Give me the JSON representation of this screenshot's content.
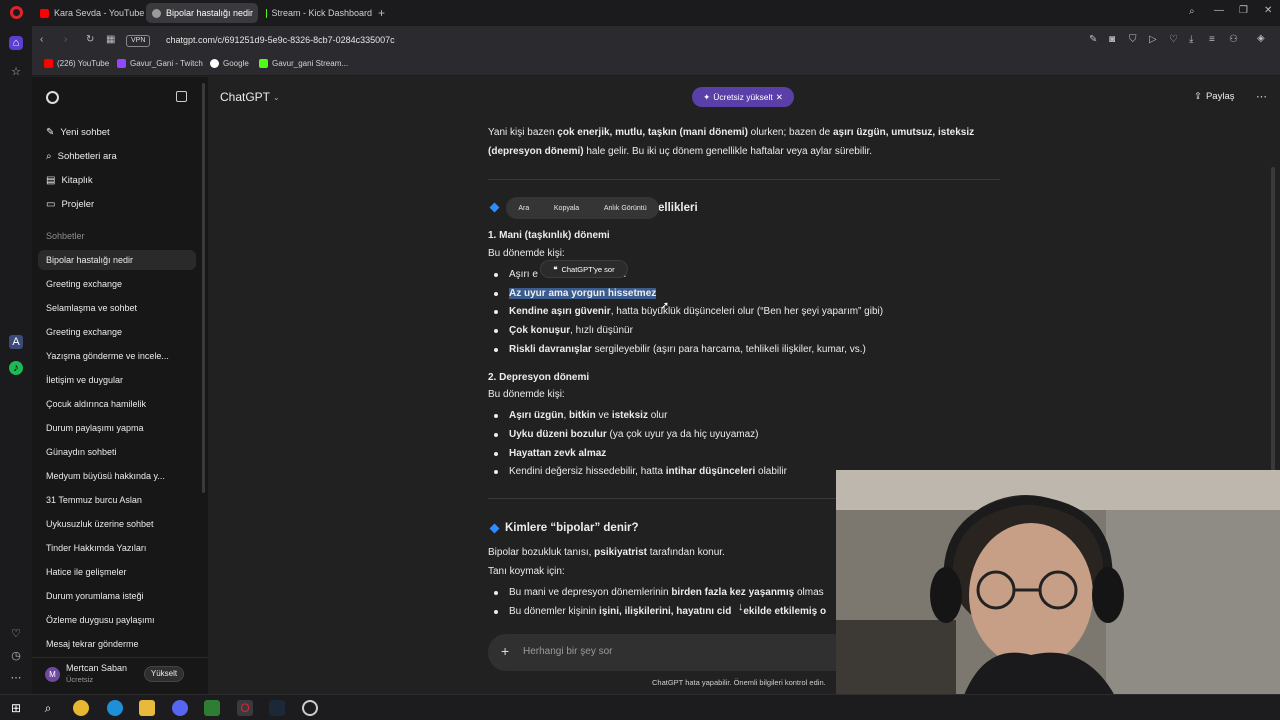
{
  "browser": {
    "tabs": [
      {
        "label": "Kara Sevda - YouTube",
        "color": "#ff0000"
      },
      {
        "label": "Bipolar hastalığı nedir",
        "color": "#9a9a9a"
      },
      {
        "label": "Stream - Kick Dashboard",
        "color": "#53fc18"
      }
    ],
    "url": "chatgpt.com/c/691251d9-5e9c-8326-8cb7-0284c335007c",
    "vpn_label": "VPN",
    "bookmarks": [
      {
        "label": "(226) YouTube",
        "color": "#ff0000"
      },
      {
        "label": "Gavur_Gani - Twitch",
        "color": "#9146ff"
      },
      {
        "label": "Google",
        "color": "#4285f4"
      },
      {
        "label": "Gavur_gani Stream...",
        "color": "#53fc18"
      }
    ]
  },
  "sidebar": {
    "nav": [
      {
        "label": "Yeni sohbet",
        "icon": "edit-icon"
      },
      {
        "label": "Sohbetleri ara",
        "icon": "search-icon"
      },
      {
        "label": "Kitaplık",
        "icon": "library-icon"
      },
      {
        "label": "Projeler",
        "icon": "folder-icon"
      }
    ],
    "section_title": "Sohbetler",
    "chats": [
      "Bipolar hastalığı nedir",
      "Greeting exchange",
      "Selamlaşma ve sohbet",
      "Greeting exchange",
      "Yazışma gönderme ve incele...",
      "İletişim ve duygular",
      "Çocuk aldırınca hamilelik",
      "Durum paylaşımı yapma",
      "Günaydın sohbeti",
      "Medyum büyüsü hakkında y...",
      "31 Temmuz burcu Aslan",
      "Uykusuzluk üzerine sohbet",
      "Tinder Hakkımda Yazıları",
      "Hatice ile gelişmeler",
      "Durum yorumlama isteği",
      "Özleme duygusu paylaşımı",
      "Mesaj tekrar gönderme"
    ],
    "user_name": "Mertcan Saban",
    "user_plan": "Ücretsiz",
    "user_initial": "M",
    "upgrade_label": "Yükselt"
  },
  "header": {
    "model": "ChatGPT",
    "upgrade_pill": "Ücretsiz yükselt",
    "share": "Paylaş"
  },
  "content": {
    "intro_1a": "Yani kişi bazen ",
    "intro_1b": "çok enerjik, mutlu, taşkın (mani dönemi)",
    "intro_1c": " olurken; bazen de ",
    "intro_1d": "aşırı üzgün, umutsuz, isteksiz",
    "intro_2a": "(depresyon dönemi)",
    "intro_2b": " hale gelir. Bu iki uç dönem genellikle haftalar veya aylar sürebilir.",
    "section1_tail": "ellikleri",
    "toolbar": [
      "Ara",
      "Kopyala",
      "Anlık Görüntü"
    ],
    "ask_popup": "ChatGPT'ye sor",
    "mani_title": "1. Mani (taşkınlık) dönemi",
    "mani_intro": "Bu dönemde kişi:",
    "mani_b1a": "Aşırı e",
    "mani_b1b": "lur",
    "mani_b2": "Az uyur ama yorgun hissetmez",
    "mani_b3a": "Kendine aşırı güvenir",
    "mani_b3b": ", hatta büyüklük düşünceleri olur (“Ben her şeyi yaparım” gibi)",
    "mani_b4a": "Çok konuşur",
    "mani_b4b": ", hızlı düşünür",
    "mani_b5a": "Riskli davranışlar",
    "mani_b5b": " sergileyebilir (aşırı para harcama, tehlikeli ilişkiler, kumar, vs.)",
    "dep_title": "2. Depresyon dönemi",
    "dep_intro": "Bu dönemde kişi:",
    "dep_b1a": "Aşırı üzgün",
    "dep_b1b": ", ",
    "dep_b1c": "bitkin",
    "dep_b1d": " ve ",
    "dep_b1e": "isteksiz",
    "dep_b1f": " olur",
    "dep_b2a": "Uyku düzeni bozulur",
    "dep_b2b": " (ya çok uyur ya da hiç uyuyamaz)",
    "dep_b3": "Hayattan zevk almaz",
    "dep_b4a": "Kendini değersiz hissedebilir, hatta ",
    "dep_b4b": "intihar düşünceleri",
    "dep_b4c": " olabilir",
    "section2_title": "Kimlere “bipolar” denir?",
    "diag_1a": "Bipolar bozukluk tanısı, ",
    "diag_1b": "psikiyatrist",
    "diag_1c": " tarafından konur.",
    "diag_2": "Tanı koymak için:",
    "diag_b1a": "Bu mani ve depresyon dönemlerinin ",
    "diag_b1b": "birden fazla kez yaşanmış",
    "diag_b1c": " olmas",
    "diag_b2a": "Bu dönemler kişinin ",
    "diag_b2b": "işini, ilişkilerini, hayatını cid",
    "diag_b2c": "ekilde etkilemiş o"
  },
  "composer": {
    "placeholder": "Herhangi bir şey sor",
    "disclaimer": "ChatGPT hata yapabilir. Önemli bilgileri kontrol edin."
  },
  "colors": {
    "accent_pill": "#5b3fa8",
    "selection": "#3b5c8f",
    "diamond": "#2f8cff"
  }
}
